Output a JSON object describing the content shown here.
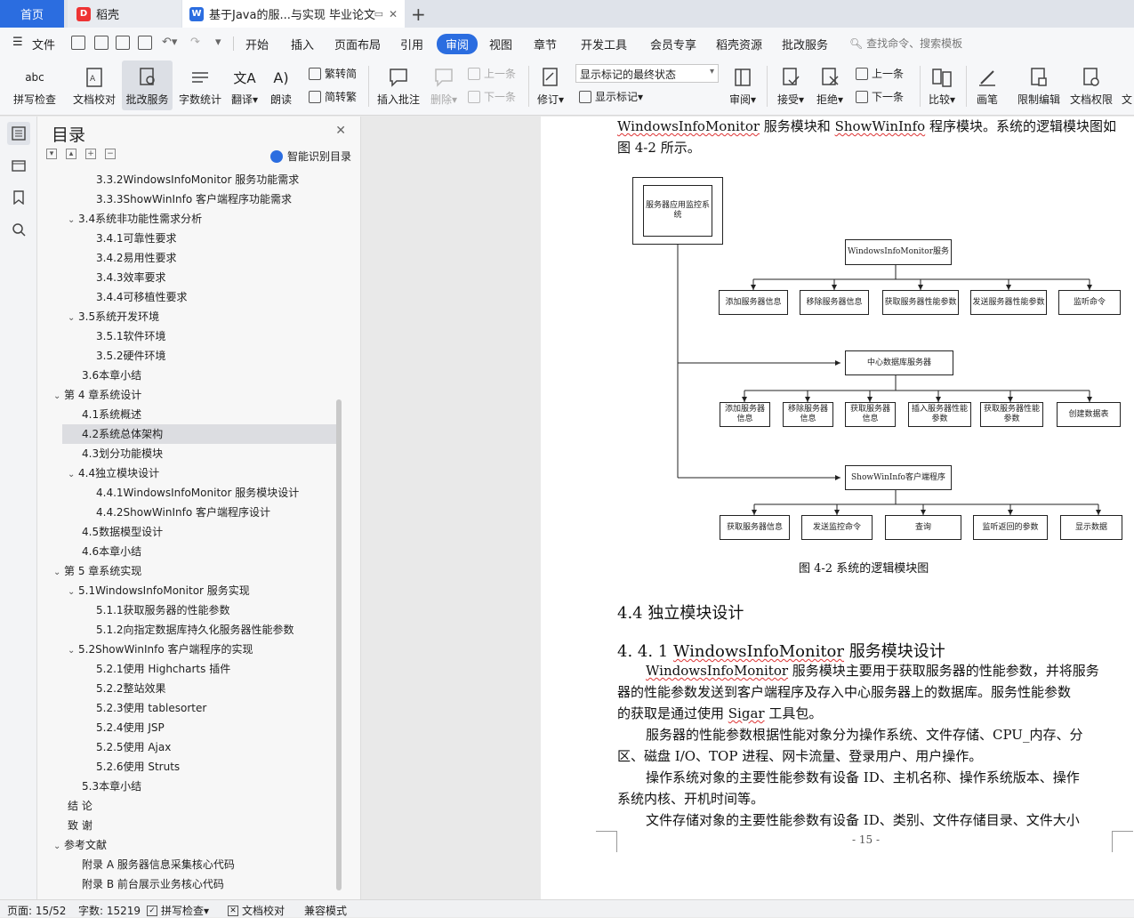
{
  "tabs": {
    "home": "首页",
    "daoke": "稻壳",
    "doc": "基于Java的服...与实现 毕业论文"
  },
  "menu": [
    "文件",
    "开始",
    "插入",
    "页面布局",
    "引用",
    "审阅",
    "视图",
    "章节",
    "开发工具",
    "会员专享",
    "稻壳资源",
    "批改服务"
  ],
  "menu_active": "审阅",
  "search_cmd": "查找命令、搜索模板",
  "ribbon": {
    "spell": "拼写检查",
    "proof": "文档校对",
    "review_service": "批改服务",
    "wordcount": "字数统计",
    "translate": "翻译",
    "read": "朗读",
    "trad": "繁转简",
    "simp": "简转繁",
    "insert_comment": "插入批注",
    "delete": "删除",
    "prev": "上一条",
    "next": "下一条",
    "track": "修订",
    "markup_state": "显示标记的最终状态",
    "show_markup": "显示标记",
    "review": "审阅",
    "accept": "接受",
    "reject": "拒绝",
    "prev2": "上一条",
    "next2": "下一条",
    "compare": "比较",
    "pen": "画笔",
    "restrict": "限制编辑",
    "rights": "文档权限",
    "more": "文"
  },
  "outline": {
    "title": "目录",
    "smart": "智能识别目录",
    "items": [
      {
        "text": "3.3.2WindowsInfoMonitor 服务功能需求",
        "level": 3,
        "caret": false
      },
      {
        "text": "3.3.3ShowWinInfo 客户端程序功能需求",
        "level": 3,
        "caret": false
      },
      {
        "text": "3.4系统非功能性需求分析",
        "level": 2,
        "caret": true
      },
      {
        "text": "3.4.1可靠性要求",
        "level": 3,
        "caret": false
      },
      {
        "text": "3.4.2易用性要求",
        "level": 3,
        "caret": false
      },
      {
        "text": "3.4.3效率要求",
        "level": 3,
        "caret": false
      },
      {
        "text": "3.4.4可移植性要求",
        "level": 3,
        "caret": false
      },
      {
        "text": "3.5系统开发环境",
        "level": 2,
        "caret": true
      },
      {
        "text": "3.5.1软件环境",
        "level": 3,
        "caret": false
      },
      {
        "text": "3.5.2硬件环境",
        "level": 3,
        "caret": false
      },
      {
        "text": "3.6本章小结",
        "level": 2,
        "caret": false
      },
      {
        "text": "第 4 章系统设计",
        "level": 1,
        "caret": true
      },
      {
        "text": "4.1系统概述",
        "level": 2,
        "caret": false
      },
      {
        "text": "4.2系统总体架构",
        "level": 2,
        "caret": false,
        "selected": true
      },
      {
        "text": "4.3划分功能模块",
        "level": 2,
        "caret": false
      },
      {
        "text": "4.4独立模块设计",
        "level": 2,
        "caret": true
      },
      {
        "text": "4.4.1WindowsInfoMonitor 服务模块设计",
        "level": 3,
        "caret": false
      },
      {
        "text": "4.4.2ShowWinInfo 客户端程序设计",
        "level": 3,
        "caret": false
      },
      {
        "text": "4.5数据模型设计",
        "level": 2,
        "caret": false
      },
      {
        "text": "4.6本章小结",
        "level": 2,
        "caret": false
      },
      {
        "text": "第 5 章系统实现",
        "level": 1,
        "caret": true
      },
      {
        "text": "5.1WindowsInfoMonitor 服务实现",
        "level": 2,
        "caret": true
      },
      {
        "text": "5.1.1获取服务器的性能参数",
        "level": 3,
        "caret": false
      },
      {
        "text": "5.1.2向指定数据库持久化服务器性能参数",
        "level": 3,
        "caret": false
      },
      {
        "text": "5.2ShowWinInfo 客户端程序的实现",
        "level": 2,
        "caret": true
      },
      {
        "text": "5.2.1使用 Highcharts 插件",
        "level": 3,
        "caret": false
      },
      {
        "text": "5.2.2整站效果",
        "level": 3,
        "caret": false
      },
      {
        "text": "5.2.3使用 tablesorter",
        "level": 3,
        "caret": false
      },
      {
        "text": "5.2.4使用 JSP",
        "level": 3,
        "caret": false
      },
      {
        "text": "5.2.5使用 Ajax",
        "level": 3,
        "caret": false
      },
      {
        "text": "5.2.6使用 Struts",
        "level": 3,
        "caret": false
      },
      {
        "text": "5.3本章小结",
        "level": 2,
        "caret": false
      },
      {
        "text": "结    论",
        "level": 1,
        "caret": false
      },
      {
        "text": "致    谢",
        "level": 1,
        "caret": false
      },
      {
        "text": "参考文献",
        "level": 1,
        "caret": true
      },
      {
        "text": "附录 A  服务器信息采集核心代码",
        "level": 2,
        "caret": false
      },
      {
        "text": "附录 B  前台展示业务核心代码",
        "level": 2,
        "caret": false
      }
    ]
  },
  "page": {
    "intro_line1_a": "WindowsInfoMonitor",
    "intro_line1_b": " 服务模块和 ",
    "intro_line1_c": "ShowWinInfo",
    "intro_line1_d": " 程序模块。系统的逻辑模块图如",
    "intro_line2": "图 4-2 所示。",
    "diagram": {
      "root": "服务器应用监控系统",
      "g1_head": "WindowsInfoMonitor服务",
      "g1_items": [
        "添加服务器信息",
        "移除服务器信息",
        "获取服务器性能参数",
        "发送服务器性能参数",
        "监听命令"
      ],
      "g2_head": "中心数据库服务器",
      "g2_items": [
        "添加服务器信息",
        "移除服务器信息",
        "获取服务器信息",
        "插入服务器性能参数",
        "获取服务器性能参数",
        "创建数据表"
      ],
      "g3_head": "ShowWinInfo客户端程序",
      "g3_items": [
        "获取服务器信息",
        "发送监控命令",
        "查询",
        "监听返回的参数",
        "显示数据"
      ]
    },
    "caption": "图 4-2   系统的逻辑模块图",
    "h2": "4.4  独立模块设计",
    "h3_num": "4. 4. 1  ",
    "h3_text": "WindowsInfoMonitor",
    "h3_tail": " 服务模块设计",
    "p1_l1_a": "WindowsInfoMonitor",
    "p1_l1_b": " 服务模块主要用于获取服务器的性能参数，并将服务",
    "p1_l2": "器的性能参数发送到客户端程序及存入中心服务器上的数据库。服务性能参数",
    "p1_l3_a": "的获取是通过使用 ",
    "p1_l3_b": "Sigar",
    "p1_l3_c": " 工具包。",
    "p2_l1": "服务器的性能参数根据性能对象分为操作系统、文件存储、CPU_内存、分",
    "p2_l2": "区、磁盘 I/O、TOP 进程、网卡流量、登录用户、用户操作。",
    "p3_l1": "操作系统对象的主要性能参数有设备 ID、主机名称、操作系统版本、操作",
    "p3_l2": "系统内核、开机时间等。",
    "p4_l1": "文件存储对象的主要性能参数有设备 ID、类别、文件存储目录、文件大小",
    "page_num": "- 15 -"
  },
  "status": {
    "page": "页面: 15/52",
    "words": "字数: 15219",
    "spell": "拼写检查",
    "proof": "文档校对",
    "compat": "兼容模式"
  }
}
